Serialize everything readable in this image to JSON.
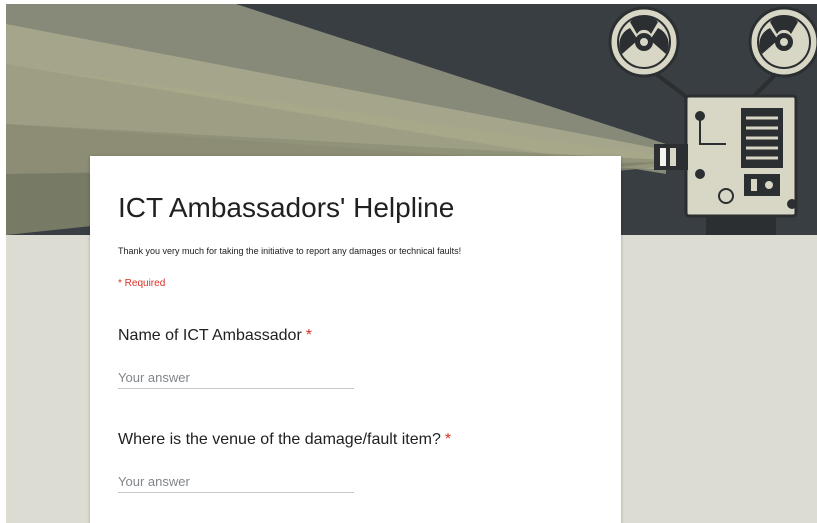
{
  "form": {
    "title": "ICT Ambassadors' Helpline",
    "description": "Thank you very much for taking the initiative to report any damages or technical faults!",
    "required_note": "* Required",
    "questions": [
      {
        "title": "Name of ICT Ambassador",
        "required_mark": "*",
        "placeholder": "Your answer"
      },
      {
        "title": "Where is the venue of the damage/fault item?",
        "required_mark": "*",
        "placeholder": "Your answer"
      }
    ]
  },
  "theme": {
    "background": "#dcdcd2",
    "required_color": "#d93025",
    "banner_dark": "#3e4447",
    "banner_beam": "#a8a88a"
  },
  "icons": {
    "banner": "film-projector-icon"
  }
}
